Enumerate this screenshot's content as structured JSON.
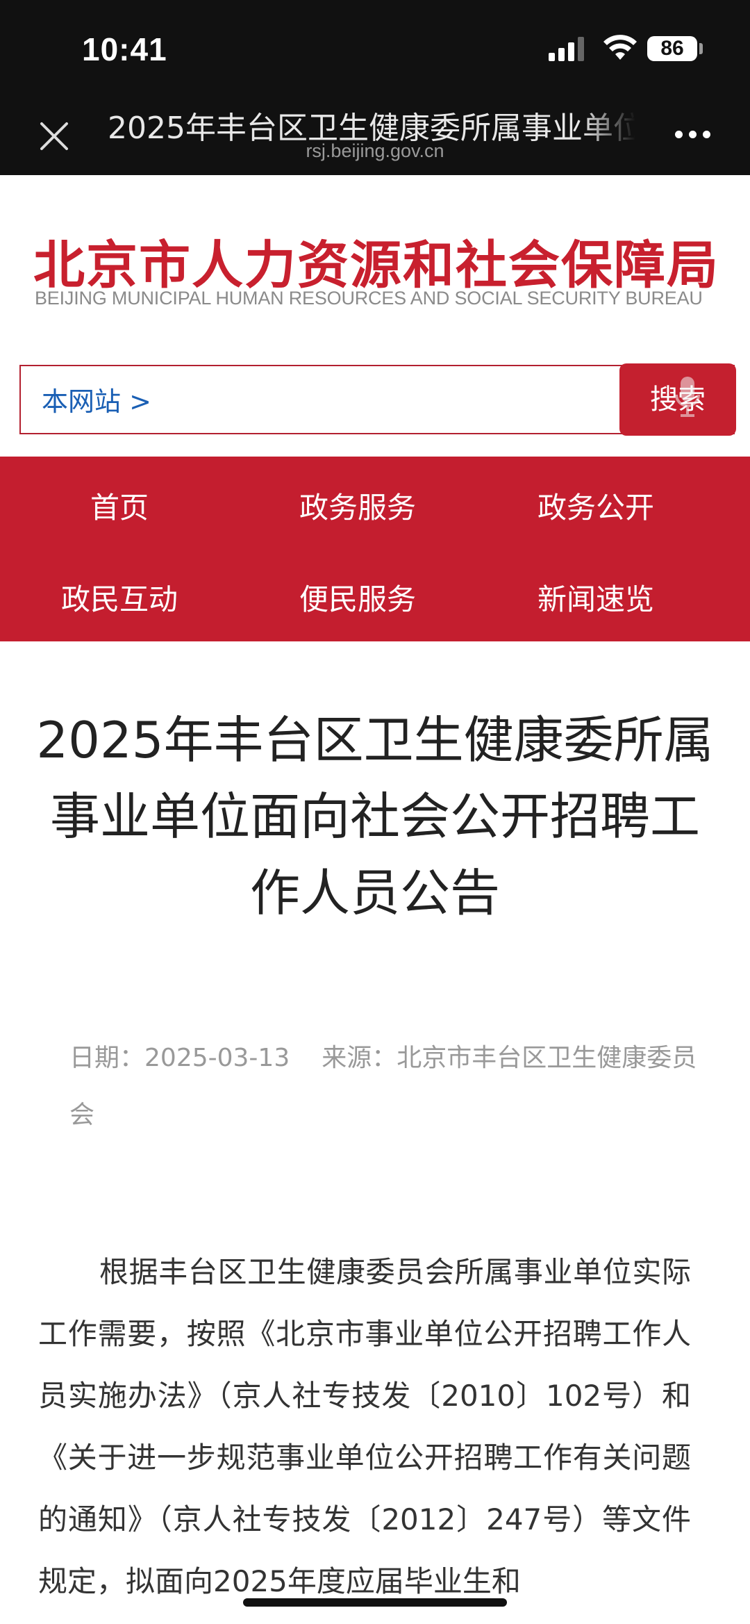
{
  "status_bar": {
    "time": "10:41",
    "battery": "86"
  },
  "browser": {
    "page_title": "2025年丰台区卫生健康委所属事业单位面向社会公开招聘工作人员公告",
    "url": "rsj.beijing.gov.cn",
    "close_icon": "close-icon",
    "more_icon": "more-icon"
  },
  "site": {
    "logo_cn": "北京市人力资源和社会保障局",
    "logo_en": "BEIJING MUNICIPAL HUMAN RESOURCES AND SOCIAL SECURITY BUREAU",
    "brand_color": "#c41e2f"
  },
  "search": {
    "scope": "本网站 >",
    "button_label": "搜索"
  },
  "nav": {
    "items": [
      {
        "label": "首页"
      },
      {
        "label": "政务服务"
      },
      {
        "label": "政务公开"
      },
      {
        "label": "政民互动"
      },
      {
        "label": "便民服务"
      },
      {
        "label": "新闻速览"
      }
    ]
  },
  "article": {
    "title": "2025年丰台区卫生健康委所属事业单位面向社会公开招聘工作人员公告",
    "date_label": "日期：",
    "date": "2025-03-13",
    "source_label": "来源：",
    "source": "北京市丰台区卫生健康委员会",
    "body": "根据丰台区卫生健康委员会所属事业单位实际工作需要，按照《北京市事业单位公开招聘工作人员实施办法》（京人社专技发〔2010〕102号）和《关于进一步规范事业单位公开招聘工作有关问题的通知》（京人社专技发〔2012〕247号）等文件规定，拟面向2025年度应届毕业生和"
  }
}
